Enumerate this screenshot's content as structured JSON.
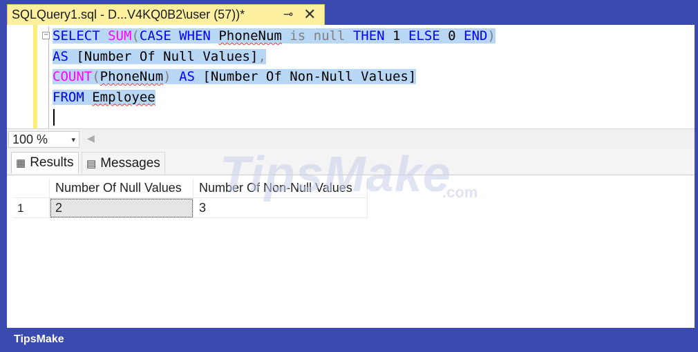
{
  "tab": {
    "title": "SQLQuery1.sql - D...V4KQ0B2\\user (57))*",
    "pin_icon": "pin-icon",
    "close_icon": "close-icon"
  },
  "editor": {
    "collapse_symbol": "−",
    "lines": [
      [
        {
          "t": "SELECT",
          "c": "kw"
        },
        {
          "t": " ",
          "c": "tx"
        },
        {
          "t": "SUM",
          "c": "fn"
        },
        {
          "t": "(",
          "c": "gr"
        },
        {
          "t": "CASE",
          "c": "kw"
        },
        {
          "t": " ",
          "c": "tx"
        },
        {
          "t": "WHEN",
          "c": "kw"
        },
        {
          "t": " ",
          "c": "tx"
        },
        {
          "t": "PhoneNum",
          "c": "tx",
          "sq": true
        },
        {
          "t": " ",
          "c": "tx"
        },
        {
          "t": "is",
          "c": "gr"
        },
        {
          "t": " ",
          "c": "tx"
        },
        {
          "t": "null",
          "c": "gr"
        },
        {
          "t": " ",
          "c": "tx"
        },
        {
          "t": "THEN",
          "c": "kw"
        },
        {
          "t": " 1 ",
          "c": "tx"
        },
        {
          "t": "ELSE",
          "c": "kw"
        },
        {
          "t": " 0 ",
          "c": "tx"
        },
        {
          "t": "END",
          "c": "kw"
        },
        {
          "t": ")",
          "c": "gr"
        }
      ],
      [
        {
          "t": "AS",
          "c": "kw"
        },
        {
          "t": " [Number Of Null Values]",
          "c": "tx"
        },
        {
          "t": ",",
          "c": "gr"
        }
      ],
      [
        {
          "t": "COUNT",
          "c": "fn"
        },
        {
          "t": "(",
          "c": "gr"
        },
        {
          "t": "PhoneNum",
          "c": "tx",
          "sq": true
        },
        {
          "t": ")",
          "c": "gr"
        },
        {
          "t": " ",
          "c": "tx"
        },
        {
          "t": "AS",
          "c": "kw"
        },
        {
          "t": " [Number Of Non-Null Values]",
          "c": "tx"
        }
      ],
      [
        {
          "t": "FROM",
          "c": "kw"
        },
        {
          "t": " ",
          "c": "tx"
        },
        {
          "t": "Employee",
          "c": "tx",
          "sq": true
        }
      ]
    ]
  },
  "zoom": {
    "value": "100 %",
    "caret": "▾",
    "scroll_glyph": "◀"
  },
  "results": {
    "tabs": [
      {
        "label": "Results",
        "icon": "grid-icon",
        "glyph": "▦"
      },
      {
        "label": "Messages",
        "icon": "messages-icon",
        "glyph": "▤"
      }
    ],
    "columns": [
      "Number Of Null Values",
      "Number Of Non-Null Values"
    ],
    "rows": [
      {
        "num": "1",
        "values": [
          "2",
          "3"
        ]
      }
    ]
  },
  "watermark": {
    "text": "TipsMake",
    "suffix": ".com"
  },
  "footer": {
    "brand": "TipsMake"
  }
}
